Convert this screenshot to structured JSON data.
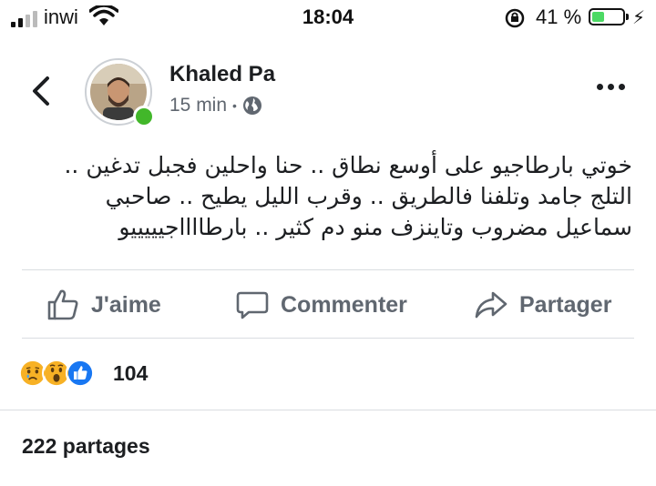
{
  "status_bar": {
    "carrier": "inwi",
    "time": "18:04",
    "battery_percent_text": "41 %",
    "battery_level": 0.41,
    "battery_color": "#4cd964"
  },
  "post": {
    "author": "Khaled Pa",
    "time_ago": "15 min",
    "separator": "•",
    "audience_icon": "globe-icon",
    "online_color": "#42b72a",
    "text_lines": [
      "خوتي بارطاجيو على أوسع نطاق .. حنا واحلين فجبل تدغين ..",
      "التلج جامد وتلفنا فالطريق .. وقرب الليل يطيح .. صاحبي",
      "سماعيل مضروب وتاينزف منو دم كثير .. بارطااااجيييييو"
    ]
  },
  "actions": {
    "like": "J'aime",
    "comment": "Commenter",
    "share": "Partager"
  },
  "reactions": {
    "icons": [
      "sad-reaction-icon",
      "wow-reaction-icon",
      "like-reaction-icon"
    ],
    "count": "104"
  },
  "shares": "222 partages"
}
